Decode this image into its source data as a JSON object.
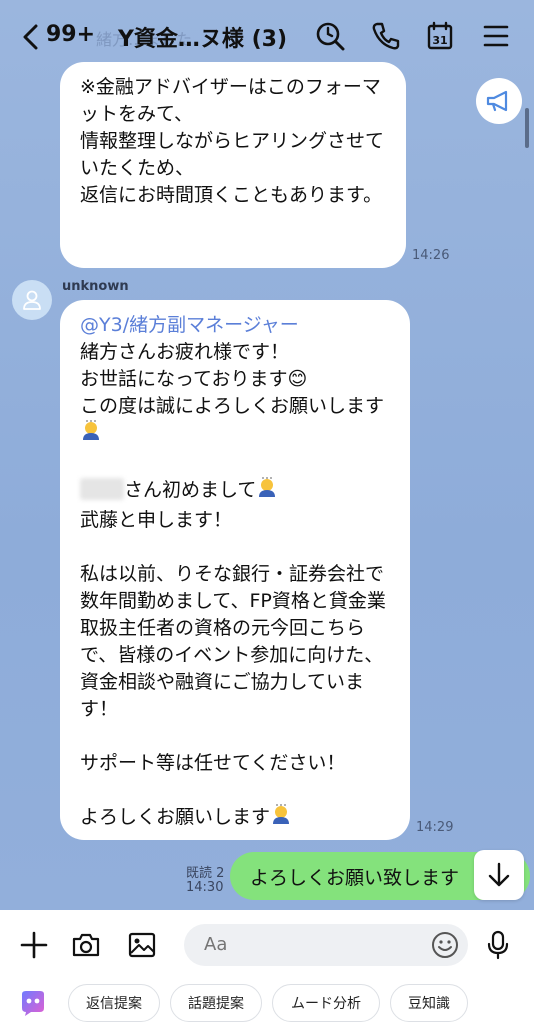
{
  "header": {
    "back_label": "<",
    "unread_count": "99+",
    "title": "Y資金…ヌ様 (3)",
    "ghost_text": "緒方…ました"
  },
  "messages": [
    {
      "text": "※金融アドバイザーはこのフォーマットをみて、\n情報整理しながらヒアリングさせていたくため、\n返信にお時間頂くこともあります。",
      "time": "14:26"
    },
    {
      "sender": "unknown",
      "mention": "@Y3/緒方副マネージャー",
      "lines_a": "緒方さんお疲れ様です！\nお世話になっております😊\nこの度は誠によろしくお願いします",
      "line_b_suffix": "さん初めまして",
      "line_c": "武藤と申します！",
      "body": "私は以前、りそな銀行・証券会社で数年間勤めまして、FP資格と貸金業取扱主任者の資格の元今回こちらで、皆様のイベント参加に向けた、資金相談や融資にご協力しています！",
      "support": "サポート等は任せてください！",
      "closing": "よろしくお願いします",
      "time": "14:29"
    }
  ],
  "my_message": {
    "text": "よろしくお願い致します",
    "read": "既読 2",
    "time": "14:30"
  },
  "input": {
    "placeholder": "Aa"
  },
  "chips": [
    "返信提案",
    "話題提案",
    "ムード分析",
    "豆知識"
  ],
  "colors": {
    "chat_bg": "#8eacd9",
    "my_bubble": "#84e27c",
    "mention": "#5b7fd8"
  },
  "icons": [
    "back-icon",
    "search-icon",
    "phone-icon",
    "calendar-icon",
    "menu-icon",
    "megaphone-icon",
    "user-icon",
    "arrow-down-icon",
    "plus-icon",
    "camera-icon",
    "image-icon",
    "emoji-icon",
    "microphone-icon",
    "ai-assistant-icon"
  ],
  "calendar_day": "31"
}
